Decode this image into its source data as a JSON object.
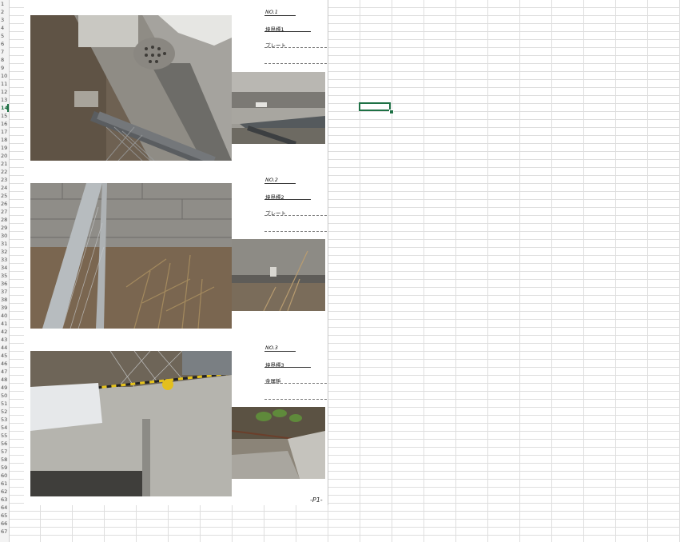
{
  "row_headers": [
    "1",
    "2",
    "3",
    "4",
    "5",
    "6",
    "7",
    "8",
    "9",
    "10",
    "11",
    "12",
    "13",
    "14",
    "15",
    "16",
    "17",
    "18",
    "19",
    "20",
    "21",
    "22",
    "23",
    "24",
    "25",
    "26",
    "27",
    "28",
    "29",
    "30",
    "31",
    "32",
    "33",
    "34",
    "35",
    "36",
    "37",
    "38",
    "39",
    "40",
    "41",
    "42",
    "43",
    "44",
    "45",
    "46",
    "47",
    "48",
    "49",
    "50",
    "51",
    "52",
    "53",
    "54",
    "55",
    "56",
    "57",
    "58",
    "59",
    "60",
    "61",
    "62",
    "63",
    "64",
    "65",
    "66",
    "67"
  ],
  "selected_row": "14",
  "entries": [
    {
      "no": "NO.1",
      "name": "境界標1",
      "type": "プレート"
    },
    {
      "no": "NO.2",
      "name": "境界標2",
      "type": "プレート"
    },
    {
      "no": "NO.3",
      "name": "境界標3",
      "type": "金属鋲"
    }
  ],
  "page_number": "-P1-",
  "colors": {
    "accent": "#1e7145",
    "grid": "#dedede"
  },
  "icons": [
    "photo-1-main",
    "photo-1-detail",
    "photo-2-main",
    "photo-2-detail",
    "photo-3-main",
    "photo-3-detail"
  ]
}
